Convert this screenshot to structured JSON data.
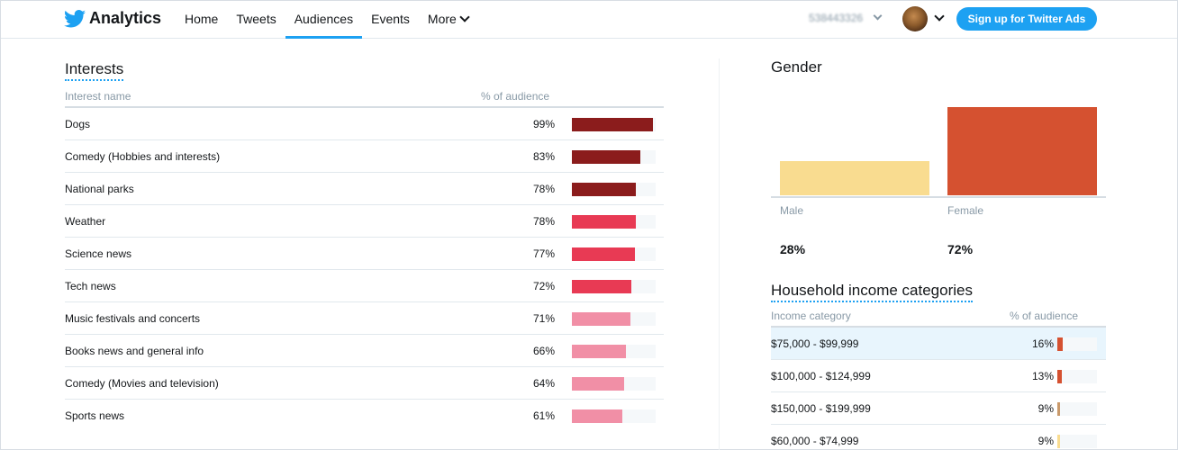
{
  "header": {
    "brand": "Analytics",
    "nav": [
      {
        "label": "Home",
        "active": false
      },
      {
        "label": "Tweets",
        "active": false
      },
      {
        "label": "Audiences",
        "active": true
      },
      {
        "label": "Events",
        "active": false
      },
      {
        "label": "More",
        "active": false
      }
    ],
    "account_id": "538443326",
    "cta_label": "Sign up for Twitter Ads",
    "accent_color": "#1da1f2"
  },
  "interests": {
    "title": "Interests",
    "col_name": "Interest name",
    "col_pct": "% of audience",
    "rows": [
      {
        "name": "Dogs",
        "pct_label": "99%",
        "value": 99,
        "color": "#8b1c1c"
      },
      {
        "name": "Comedy (Hobbies and interests)",
        "pct_label": "83%",
        "value": 83,
        "color": "#8b1c1c"
      },
      {
        "name": "National parks",
        "pct_label": "78%",
        "value": 78,
        "color": "#8b1c1c"
      },
      {
        "name": "Weather",
        "pct_label": "78%",
        "value": 78,
        "color": "#e83a54"
      },
      {
        "name": "Science news",
        "pct_label": "77%",
        "value": 77,
        "color": "#e83a54"
      },
      {
        "name": "Tech news",
        "pct_label": "72%",
        "value": 72,
        "color": "#e83a54"
      },
      {
        "name": "Music festivals and concerts",
        "pct_label": "71%",
        "value": 71,
        "color": "#f18fa6"
      },
      {
        "name": "Books news and general info",
        "pct_label": "66%",
        "value": 66,
        "color": "#f18fa6"
      },
      {
        "name": "Comedy (Movies and television)",
        "pct_label": "64%",
        "value": 64,
        "color": "#f18fa6"
      },
      {
        "name": "Sports news",
        "pct_label": "61%",
        "value": 61,
        "color": "#f18fa6"
      }
    ]
  },
  "gender": {
    "title": "Gender",
    "items": [
      {
        "label": "Male",
        "pct_label": "28%",
        "value": 28,
        "color": "#f9dc90"
      },
      {
        "label": "Female",
        "pct_label": "72%",
        "value": 72,
        "color": "#d55130"
      }
    ]
  },
  "income": {
    "title": "Household income categories",
    "col_name": "Income category",
    "col_pct": "% of audience",
    "rows": [
      {
        "name": "$75,000 - $99,999",
        "pct_label": "16%",
        "value": 16,
        "color": "#d55130",
        "highlight": true
      },
      {
        "name": "$100,000 - $124,999",
        "pct_label": "13%",
        "value": 13,
        "color": "#d55130",
        "highlight": false
      },
      {
        "name": "$150,000 - $199,999",
        "pct_label": "9%",
        "value": 9,
        "color": "#c9996a",
        "highlight": false
      },
      {
        "name": "$60,000 - $74,999",
        "pct_label": "9%",
        "value": 9,
        "color": "#f9dc90",
        "highlight": false
      }
    ]
  }
}
